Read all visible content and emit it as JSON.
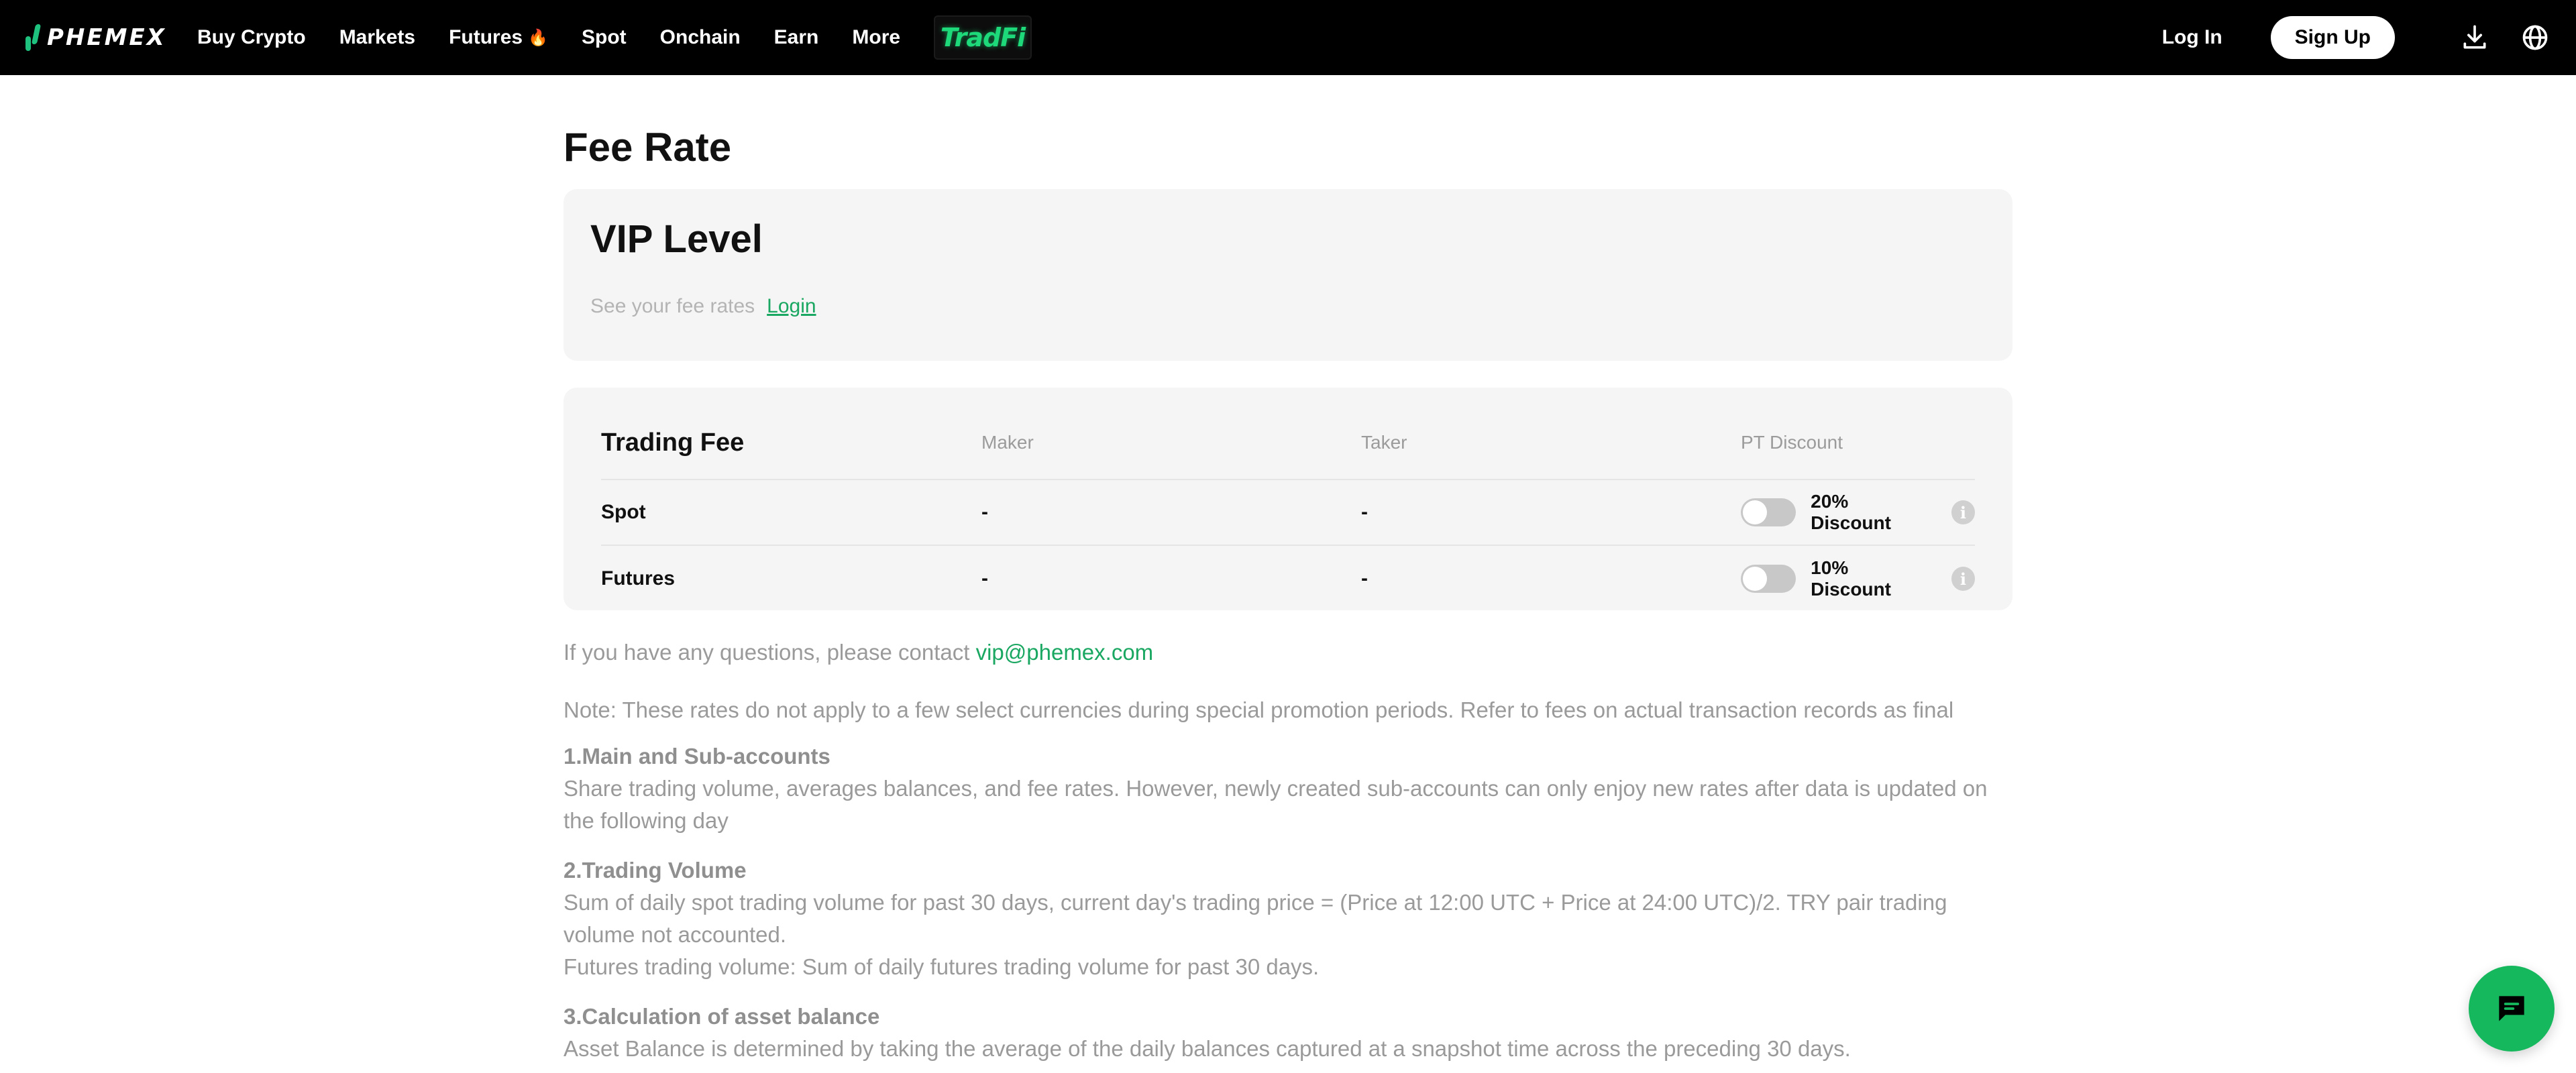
{
  "brand": {
    "name": "PHEMEX",
    "accent": "#1aa761"
  },
  "nav": {
    "items": [
      "Buy Crypto",
      "Markets",
      "Futures",
      "Spot",
      "Onchain",
      "Earn",
      "More"
    ],
    "tradfi": "TradFi",
    "login": "Log In",
    "signup": "Sign Up"
  },
  "page": {
    "title": "Fee Rate"
  },
  "vip": {
    "title": "VIP Level",
    "subtitle": "See your fee rates",
    "login_link": "Login"
  },
  "fee_table": {
    "title": "Trading Fee",
    "headers": [
      "Maker",
      "Taker",
      "PT Discount"
    ],
    "rows": [
      {
        "name": "Spot",
        "maker": "-",
        "taker": "-",
        "discount": "20% Discount"
      },
      {
        "name": "Futures",
        "maker": "-",
        "taker": "-",
        "discount": "10% Discount"
      }
    ]
  },
  "contact": {
    "text": "If you have any questions, please contact",
    "email": "vip@phemex.com"
  },
  "note": "Note: These rates do not apply to a few select currencies during special promotion periods. Refer to fees on actual transaction records as final",
  "sections": [
    {
      "heading": "1.Main and Sub-accounts",
      "lines": [
        "Share trading volume, averages balances, and fee rates. However, newly created sub-accounts can only enjoy new rates after data is updated on the following day"
      ]
    },
    {
      "heading": "2.Trading Volume",
      "lines": [
        "Sum of daily spot trading volume for past 30 days, current day's trading price = (Price at 12:00 UTC + Price at 24:00 UTC)/2. TRY pair trading volume not accounted.",
        "Futures trading volume: Sum of daily futures trading volume for past 30 days."
      ]
    },
    {
      "heading": "3.Calculation of asset balance",
      "lines": [
        "Asset Balance is determined by taking the average of the daily balances captured at a snapshot time across the preceding 30 days."
      ]
    }
  ]
}
